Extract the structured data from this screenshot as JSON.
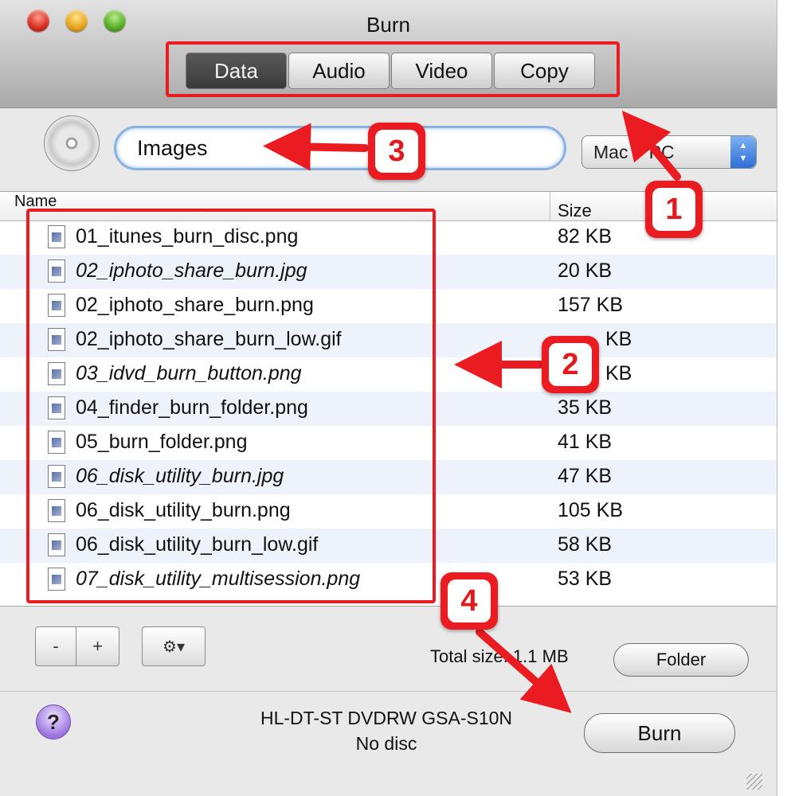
{
  "window": {
    "title": "Burn"
  },
  "tabs": [
    {
      "label": "Data",
      "active": true
    },
    {
      "label": "Audio",
      "active": false
    },
    {
      "label": "Video",
      "active": false
    },
    {
      "label": "Copy",
      "active": false
    }
  ],
  "search": {
    "value": "Images"
  },
  "format_select": {
    "value": "Mac + PC"
  },
  "columns": {
    "name": "Name",
    "size": "Size"
  },
  "files": [
    {
      "name": "01_itunes_burn_disc.png",
      "size": "82 KB",
      "italic": false
    },
    {
      "name": "02_iphoto_share_burn.jpg",
      "size": "20 KB",
      "italic": true
    },
    {
      "name": "02_iphoto_share_burn.png",
      "size": "157 KB",
      "italic": false
    },
    {
      "name": "02_iphoto_share_burn_low.gif",
      "size": "KB",
      "italic": false
    },
    {
      "name": "03_idvd_burn_button.png",
      "size": "KB",
      "italic": true
    },
    {
      "name": "04_finder_burn_folder.png",
      "size": "35 KB",
      "italic": false
    },
    {
      "name": "05_burn_folder.png",
      "size": "41 KB",
      "italic": false
    },
    {
      "name": "06_disk_utility_burn.jpg",
      "size": "47 KB",
      "italic": true
    },
    {
      "name": "06_disk_utility_burn.png",
      "size": "105 KB",
      "italic": false
    },
    {
      "name": "06_disk_utility_burn_low.gif",
      "size": "58 KB",
      "italic": false
    },
    {
      "name": "07_disk_utility_multisession.png",
      "size": "53 KB",
      "italic": true
    }
  ],
  "buttons": {
    "minus": "-",
    "plus": "+",
    "gear": "⚙▾",
    "folder": "Folder",
    "burn": "Burn",
    "help": "?"
  },
  "total": "Total size: 1.1 MB",
  "drive": {
    "name": "HL-DT-ST DVDRW GSA-S10N",
    "status": "No disc"
  },
  "callouts": [
    "1",
    "2",
    "3",
    "4"
  ],
  "colors": {
    "annotation": "#ea1c22",
    "active_tab": "#3f3f3f",
    "row_alt": "#edf2fb"
  }
}
